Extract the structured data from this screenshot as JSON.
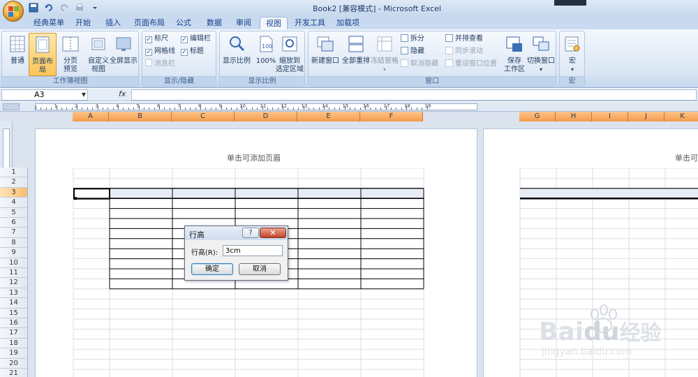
{
  "window": {
    "title": "Book2 [兼容模式] - Microsoft Excel"
  },
  "tabs": [
    {
      "label": "经典菜单"
    },
    {
      "label": "开始"
    },
    {
      "label": "插入"
    },
    {
      "label": "页面布局"
    },
    {
      "label": "公式"
    },
    {
      "label": "数据"
    },
    {
      "label": "审阅"
    },
    {
      "label": "视图",
      "active": true
    },
    {
      "label": "开发工具"
    },
    {
      "label": "加载项"
    }
  ],
  "ribbon": {
    "workbook_views": {
      "label": "工作簿视图",
      "normal": "普通",
      "page_layout": "页面布局",
      "page_break_1": "分页",
      "page_break_2": "预览",
      "custom_1": "自定义",
      "custom_2": "视图",
      "full_screen": "全屏显示"
    },
    "show_hide": {
      "label": "显示/隐藏",
      "ruler": "标尺",
      "formula_bar": "编辑栏",
      "gridlines": "网格线",
      "headings": "标题",
      "message_bar": "消息栏"
    },
    "zoom": {
      "label": "显示比例",
      "zoom": "显示比例",
      "hundred": "100%",
      "zoom_selection_1": "缩放到",
      "zoom_selection_2": "选定区域"
    },
    "window": {
      "label": "窗口",
      "new_window": "新建窗口",
      "arrange_all": "全部重排",
      "freeze_panes": "冻结窗格",
      "split": "拆分",
      "hide": "隐藏",
      "unhide": "取消隐藏",
      "side_by_side": "并排查看",
      "sync_scroll": "同步滚动",
      "reset_position": "重设窗口位置",
      "save_workspace_1": "保存",
      "save_workspace_2": "工作区",
      "switch_windows": "切换窗口"
    },
    "macros": {
      "label": "宏",
      "macro": "宏"
    }
  },
  "formula_bar": {
    "name_box": "A3",
    "fx": "fx",
    "value": ""
  },
  "ruler_labels": [
    "1",
    "2",
    "3",
    "4",
    "5",
    "6",
    "7",
    "8",
    "9",
    "10",
    "11",
    "12",
    "13",
    "14",
    "15",
    "16",
    "17",
    "18",
    "19"
  ],
  "columns_page1": [
    "A",
    "B",
    "C",
    "D",
    "E",
    "F"
  ],
  "columns_page2": [
    "G",
    "H",
    "I",
    "J",
    "K"
  ],
  "rows": [
    "1",
    "2",
    "3",
    "4",
    "5",
    "6",
    "7",
    "8",
    "9",
    "10",
    "11",
    "12",
    "13",
    "14",
    "15",
    "16",
    "17",
    "18",
    "19",
    "20",
    "21"
  ],
  "page": {
    "header_placeholder": "单击可添加页眉",
    "header_placeholder_partial": "单击可"
  },
  "dialog": {
    "title": "行高",
    "help": "?",
    "close": "✕",
    "field_label": "行高(R):",
    "value": "3cm",
    "ok": "确定",
    "cancel": "取消"
  },
  "watermark": {
    "brand": "Bai",
    "brand2": "du",
    "cn": "经验",
    "url": "jingyan.baidu.com"
  }
}
